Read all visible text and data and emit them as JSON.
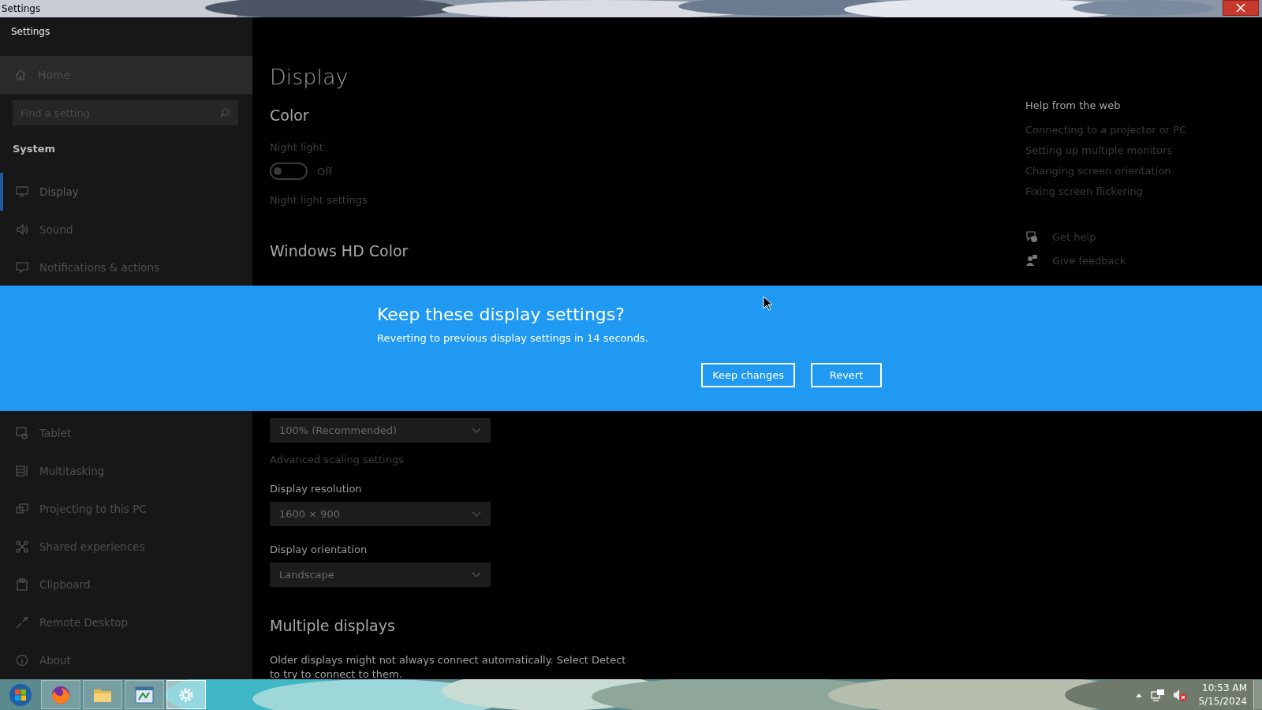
{
  "window": {
    "title": "Settings"
  },
  "sidebar": {
    "app_title": "Settings",
    "home": "Home",
    "search": {
      "placeholder": "Find a setting"
    },
    "section": "System",
    "items_top": [
      {
        "label": "Display",
        "selected": true
      },
      {
        "label": "Sound",
        "selected": false
      },
      {
        "label": "Notifications & actions",
        "selected": false
      }
    ],
    "items_bottom": [
      {
        "label": "Tablet",
        "selected": false
      },
      {
        "label": "Multitasking",
        "selected": false
      },
      {
        "label": "Projecting to this PC",
        "selected": false
      },
      {
        "label": "Shared experiences",
        "selected": false
      },
      {
        "label": "Clipboard",
        "selected": false
      },
      {
        "label": "Remote Desktop",
        "selected": false
      },
      {
        "label": "About",
        "selected": false
      }
    ]
  },
  "main": {
    "title": "Display",
    "color_heading": "Color",
    "night_light": {
      "label": "Night light",
      "on": false,
      "state_text": "Off",
      "settings_link": "Night light settings"
    },
    "hd_heading": "Windows HD Color",
    "scale_dropdown": "100% (Recommended)",
    "advanced_scaling_link": "Advanced scaling settings",
    "resolution": {
      "label": "Display resolution",
      "value": "1600 × 900"
    },
    "orientation": {
      "label": "Display orientation",
      "value": "Landscape"
    },
    "multiple_heading": "Multiple displays",
    "multiple_text": "Older displays might not always connect automatically. Select Detect to try to connect to them."
  },
  "help": {
    "heading": "Help from the web",
    "links": [
      "Connecting to a projector or PC",
      "Setting up multiple monitors",
      "Changing screen orientation",
      "Fixing screen flickering"
    ],
    "actions": [
      "Get help",
      "Give feedback"
    ]
  },
  "dialog": {
    "title": "Keep these display settings?",
    "message": "Reverting to previous display settings in 14 seconds.",
    "buttons": [
      "Keep changes",
      "Revert"
    ]
  },
  "taskbar": {
    "apps": [
      {
        "active": false
      },
      {
        "active": false
      },
      {
        "active": false
      },
      {
        "active": true
      }
    ],
    "time": "10:53 AM",
    "date": "5/15/2024"
  }
}
